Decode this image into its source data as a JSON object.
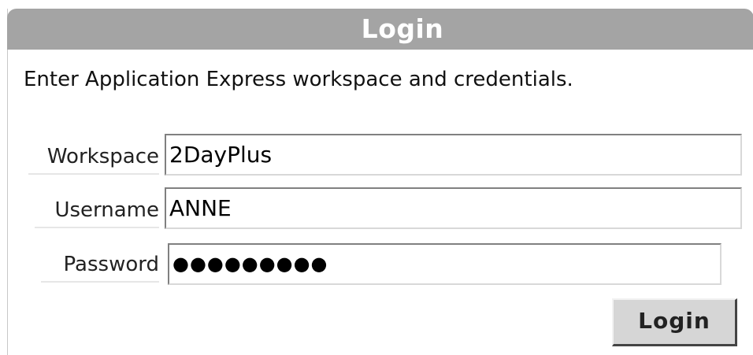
{
  "panel": {
    "title": "Login",
    "instructions": "Enter Application Express workspace and credentials."
  },
  "form": {
    "workspace": {
      "label": "Workspace",
      "value": "2DayPlus"
    },
    "username": {
      "label": "Username",
      "value": "ANNE"
    },
    "password": {
      "label": "Password",
      "value_masked": "●●●●●●●●●"
    },
    "submit_label": "Login"
  },
  "colors": {
    "header_background": "#a4a4a4",
    "header_text": "#ffffff",
    "button_background": "#d6d6d6"
  }
}
